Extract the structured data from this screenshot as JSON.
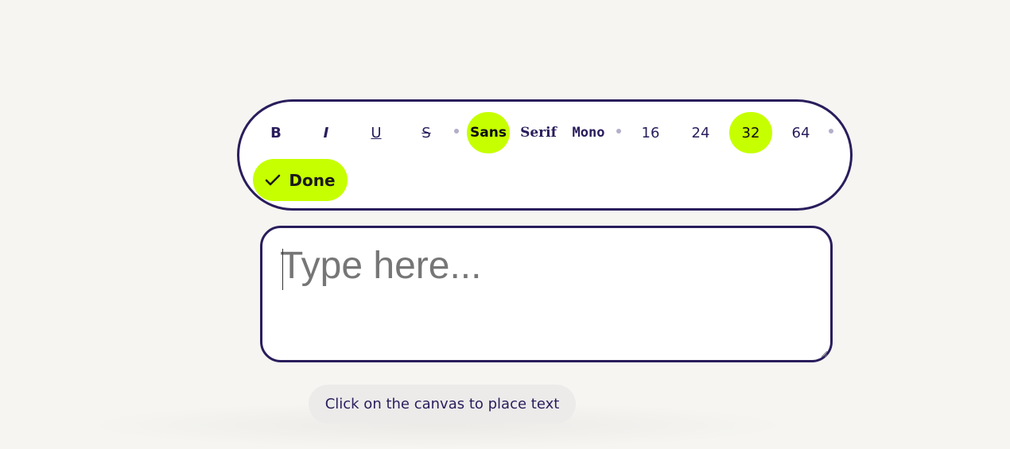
{
  "toolbar": {
    "style_buttons": [
      {
        "label": "B",
        "name": "bold"
      },
      {
        "label": "I",
        "name": "italic"
      },
      {
        "label": "U",
        "name": "underline"
      },
      {
        "label": "S",
        "name": "strikethrough"
      }
    ],
    "font_buttons": [
      {
        "label": "Sans",
        "name": "sans",
        "active": true
      },
      {
        "label": "Serif",
        "name": "serif",
        "active": false
      },
      {
        "label": "Mono",
        "name": "mono",
        "active": false
      }
    ],
    "size_buttons": [
      {
        "label": "16",
        "active": false
      },
      {
        "label": "24",
        "active": false
      },
      {
        "label": "32",
        "active": true
      },
      {
        "label": "64",
        "active": false
      }
    ],
    "done_label": "Done",
    "done_icon": "check-icon"
  },
  "editor": {
    "placeholder": "Type here..."
  },
  "hint": {
    "text": "Click on the canvas to place text"
  },
  "colors": {
    "accent": "#c6ff00",
    "border": "#2a1d5c",
    "background": "#f6f5f2"
  }
}
